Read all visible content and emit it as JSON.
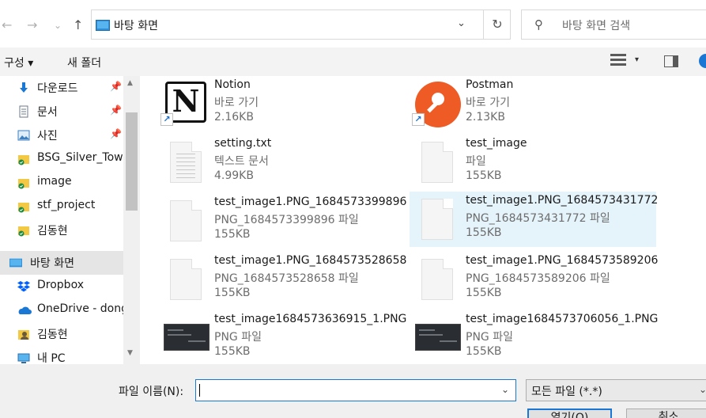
{
  "address": {
    "path": "바탕 화면",
    "search_placeholder": "바탕 화면 검색"
  },
  "nav": {
    "back_icon": "←",
    "forward_icon": "→",
    "recent_icon": "⌄",
    "up_icon": "↑",
    "dropdown_icon": "⌄",
    "refresh_icon": "↻",
    "search_icon": "⚲"
  },
  "toolbar": {
    "organize": "구성 ▾",
    "new_folder": "새 폴더",
    "caret": "▾"
  },
  "sidebar": {
    "items": [
      {
        "label": "다운로드",
        "icon": "download-icon",
        "pinned": true
      },
      {
        "label": "문서",
        "icon": "documents-icon",
        "pinned": true
      },
      {
        "label": "사진",
        "icon": "pictures-icon",
        "pinned": true
      },
      {
        "label": "BSG_Silver_Town",
        "icon": "folder-sync-icon"
      },
      {
        "label": "image",
        "icon": "folder-sync-icon"
      },
      {
        "label": "stf_project",
        "icon": "folder-sync-icon"
      },
      {
        "label": "김동현",
        "icon": "folder-sync-icon"
      },
      {
        "label": "바탕 화면",
        "icon": "desktop-icon",
        "selected": true
      },
      {
        "label": "Dropbox",
        "icon": "dropbox-icon"
      },
      {
        "label": "OneDrive - dong",
        "icon": "onedrive-icon"
      },
      {
        "label": "김동현",
        "icon": "user-icon"
      },
      {
        "label": "내 PC",
        "icon": "pc-icon"
      }
    ],
    "pin_glyph": "📌",
    "scroll_up": "▲",
    "scroll_down": "▼"
  },
  "files": [
    {
      "name": "Notion",
      "type": "바로 가기",
      "size": "2.16KB",
      "icon": "notion-icon",
      "shortcut": true
    },
    {
      "name": "Postman",
      "type": "바로 가기",
      "size": "2.13KB",
      "icon": "postman-icon",
      "shortcut": true
    },
    {
      "name": "setting.txt",
      "type": "텍스트 문서",
      "size": "4.99KB",
      "icon": "text-file-icon"
    },
    {
      "name": "test_image",
      "type": "파일",
      "size": "155KB",
      "icon": "blank-file-icon"
    },
    {
      "name": "test_image1.PNG_1684573399896",
      "type": "PNG_1684573399896 파일",
      "size": "155KB",
      "icon": "blank-file-icon"
    },
    {
      "name": "test_image1.PNG_1684573431772",
      "type": "PNG_1684573431772 파일",
      "size": "155KB",
      "icon": "blank-file-icon",
      "selected": true
    },
    {
      "name": "test_image1.PNG_1684573528658",
      "type": "PNG_1684573528658 파일",
      "size": "155KB",
      "icon": "blank-file-icon"
    },
    {
      "name": "test_image1.PNG_1684573589206",
      "type": "PNG_1684573589206 파일",
      "size": "155KB",
      "icon": "blank-file-icon"
    },
    {
      "name": "test_image1684573636915_1.PNG",
      "type": "PNG 파일",
      "size": "155KB",
      "icon": "image-thumbnail-icon"
    },
    {
      "name": "test_image1684573706056_1.PNG",
      "type": "PNG 파일",
      "size": "155KB",
      "icon": "image-thumbnail-icon"
    }
  ],
  "bottom": {
    "filename_label": "파일 이름(N):",
    "filename_value": "",
    "filetype": "모든 파일 (*.*)",
    "dropdown_icon": "⌄",
    "open_button": "열기(O)",
    "cancel_button": "취소"
  },
  "colors": {
    "accent": "#1a78d4",
    "selection": "#e5f3fb",
    "sidebar_selected": "#e5e5e5"
  }
}
